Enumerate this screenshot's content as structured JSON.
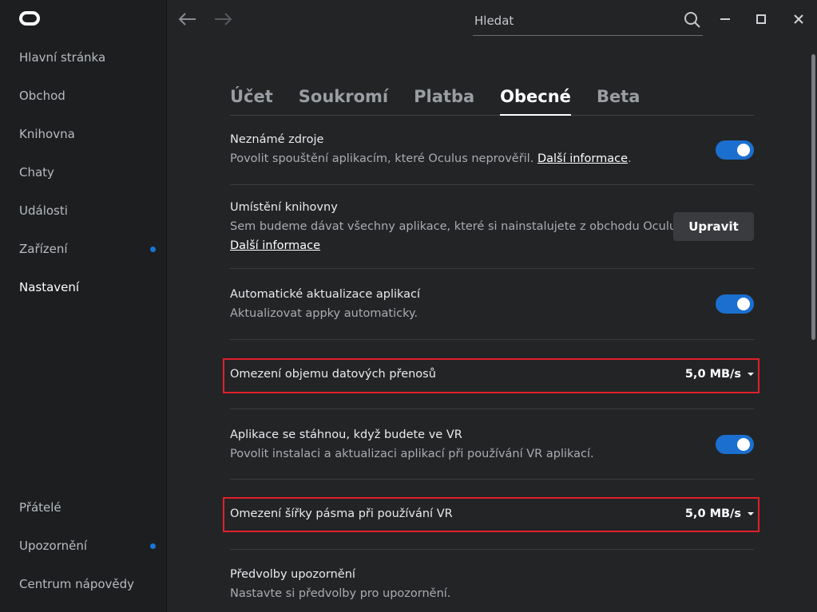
{
  "app": {
    "logo_icon": "oculus-logo-icon"
  },
  "sidebar": {
    "items": [
      {
        "label": "Hlavní stránka",
        "active": false,
        "dot": false
      },
      {
        "label": "Obchod",
        "active": false,
        "dot": false
      },
      {
        "label": "Knihovna",
        "active": false,
        "dot": false
      },
      {
        "label": "Chaty",
        "active": false,
        "dot": false
      },
      {
        "label": "Události",
        "active": false,
        "dot": false
      },
      {
        "label": "Zařízení",
        "active": false,
        "dot": true
      },
      {
        "label": "Nastavení",
        "active": true,
        "dot": false
      }
    ],
    "bottom_items": [
      {
        "label": "Přátelé",
        "dot": false
      },
      {
        "label": "Upozornění",
        "dot": true
      },
      {
        "label": "Centrum nápovědy",
        "dot": false
      }
    ]
  },
  "topbar": {
    "search_placeholder": "Hledat",
    "back_icon": "back-arrow-icon",
    "forward_icon": "forward-arrow-icon"
  },
  "tabs": [
    {
      "label": "Účet",
      "active": false
    },
    {
      "label": "Soukromí",
      "active": false
    },
    {
      "label": "Platba",
      "active": false
    },
    {
      "label": "Obecné",
      "active": true
    },
    {
      "label": "Beta",
      "active": false
    }
  ],
  "settings": {
    "unknown_sources": {
      "title": "Neznámé zdroje",
      "desc": "Povolit spouštění aplikacím, které Oculus neprověřil.",
      "link": "Další informace",
      "enabled": true
    },
    "library_location": {
      "title": "Umístění knihovny",
      "desc": "Sem budeme dávat všechny aplikace, které si nainstalujete z obchodu Oculus.",
      "link": "Další informace",
      "button": "Upravit"
    },
    "auto_updates": {
      "title": "Automatické aktualizace aplikací",
      "desc": "Aktualizovat appky automaticky.",
      "enabled": true
    },
    "data_limit": {
      "title": "Omezení objemu datových přenosů",
      "value": "5,0 MB/s"
    },
    "vr_downloads": {
      "title": "Aplikace se stáhnou, když budete ve VR",
      "desc": "Povolit instalaci a aktualizaci aplikací při používání VR aplikací.",
      "enabled": true
    },
    "vr_bandwidth": {
      "title": "Omezení šířky pásma při používání VR",
      "value": "5,0 MB/s"
    },
    "notification_prefs": {
      "title": "Předvolby upozornění",
      "desc": "Nastavte si předvolby pro upozornění."
    }
  },
  "colors": {
    "accent": "#1b6fcf",
    "highlight": "#e0202a",
    "dot": "#1b75d3"
  }
}
